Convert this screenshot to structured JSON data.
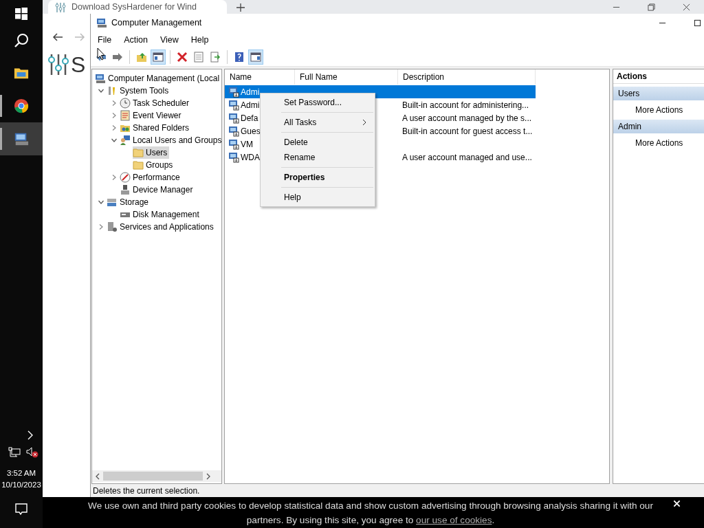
{
  "taskbar": {
    "apps": [
      {
        "kind": "explorer",
        "open": false,
        "selected": false
      },
      {
        "kind": "browser",
        "open": true,
        "selected": false
      },
      {
        "kind": "computer-management",
        "open": true,
        "selected": true
      }
    ],
    "clock_time": "3:52 AM",
    "clock_date": "10/10/2023"
  },
  "browser": {
    "tab_title": "Download SysHardener for Wind",
    "logo_text": "S"
  },
  "window": {
    "title": "Computer Management",
    "menu": [
      "File",
      "Action",
      "View",
      "Help"
    ],
    "toolbar": [
      [
        {
          "kind": "back",
          "pressed": false
        },
        {
          "kind": "forward",
          "pressed": false
        }
      ],
      [
        {
          "kind": "up",
          "pressed": false
        },
        {
          "kind": "console-tree",
          "pressed": true
        }
      ],
      [
        {
          "kind": "delete",
          "pressed": false
        },
        {
          "kind": "properties",
          "pressed": false
        },
        {
          "kind": "export",
          "pressed": false
        }
      ],
      [
        {
          "kind": "help",
          "pressed": false
        },
        {
          "kind": "action-pane",
          "pressed": true
        }
      ]
    ],
    "tree": [
      {
        "label": "Computer Management (Local",
        "kind": "computer",
        "selected": false,
        "children": [
          {
            "label": "System Tools",
            "kind": "tools",
            "expanded": true,
            "selected": false,
            "children": [
              {
                "label": "Task Scheduler",
                "kind": "clock",
                "expanded": false,
                "selected": false
              },
              {
                "label": "Event Viewer",
                "kind": "log",
                "expanded": false,
                "selected": false
              },
              {
                "label": "Shared Folders",
                "kind": "share",
                "expanded": false,
                "selected": false
              },
              {
                "label": "Local Users and Groups",
                "kind": "users",
                "expanded": true,
                "selected": false,
                "children": [
                  {
                    "label": "Users",
                    "kind": "folder",
                    "selected": true
                  },
                  {
                    "label": "Groups",
                    "kind": "folder",
                    "selected": false
                  }
                ]
              },
              {
                "label": "Performance",
                "kind": "performance",
                "expanded": false,
                "selected": false
              },
              {
                "label": "Device Manager",
                "kind": "device",
                "selected": false
              }
            ]
          },
          {
            "label": "Storage",
            "kind": "storage",
            "expanded": true,
            "selected": false,
            "children": [
              {
                "label": "Disk Management",
                "kind": "disk",
                "selected": false
              }
            ]
          },
          {
            "label": "Services and Applications",
            "kind": "services",
            "expanded": false,
            "selected": false
          }
        ]
      }
    ],
    "columns": [
      "Name",
      "Full Name",
      "Description"
    ],
    "rows": [
      {
        "name": "Admi",
        "selected": true
      },
      {
        "name": "Admi",
        "description": "Built-in account for administering...",
        "selected": false
      },
      {
        "name": "Defa",
        "description": "A user account managed by the s...",
        "selected": false
      },
      {
        "name": "Gues",
        "description": "Built-in account for guest access t...",
        "selected": false
      },
      {
        "name": "VM",
        "selected": false
      },
      {
        "name": "WDA",
        "description": "A user account managed and use...",
        "selected": false
      }
    ],
    "actions": {
      "title": "Actions",
      "sections": [
        {
          "title": "Users",
          "items": [
            "More Actions"
          ]
        },
        {
          "title": "Admin",
          "items": [
            "More Actions"
          ]
        }
      ]
    },
    "context_menu": [
      {
        "kind": "item",
        "label": "Set Password..."
      },
      {
        "kind": "separator"
      },
      {
        "kind": "item",
        "label": "All Tasks",
        "submenu": true
      },
      {
        "kind": "separator"
      },
      {
        "kind": "item",
        "label": "Delete"
      },
      {
        "kind": "item",
        "label": "Rename"
      },
      {
        "kind": "separator"
      },
      {
        "kind": "item",
        "label": "Properties",
        "default": true
      },
      {
        "kind": "separator"
      },
      {
        "kind": "item",
        "label": "Help"
      }
    ],
    "status_bar": "Deletes the current selection."
  },
  "cookie_banner": {
    "text": "We use own and third party cookies to develop statistical data and show custom advertising through browsing analysis sharing it with our partners. By using this site, you agree to ",
    "link": "our use of cookies",
    "end": "."
  }
}
